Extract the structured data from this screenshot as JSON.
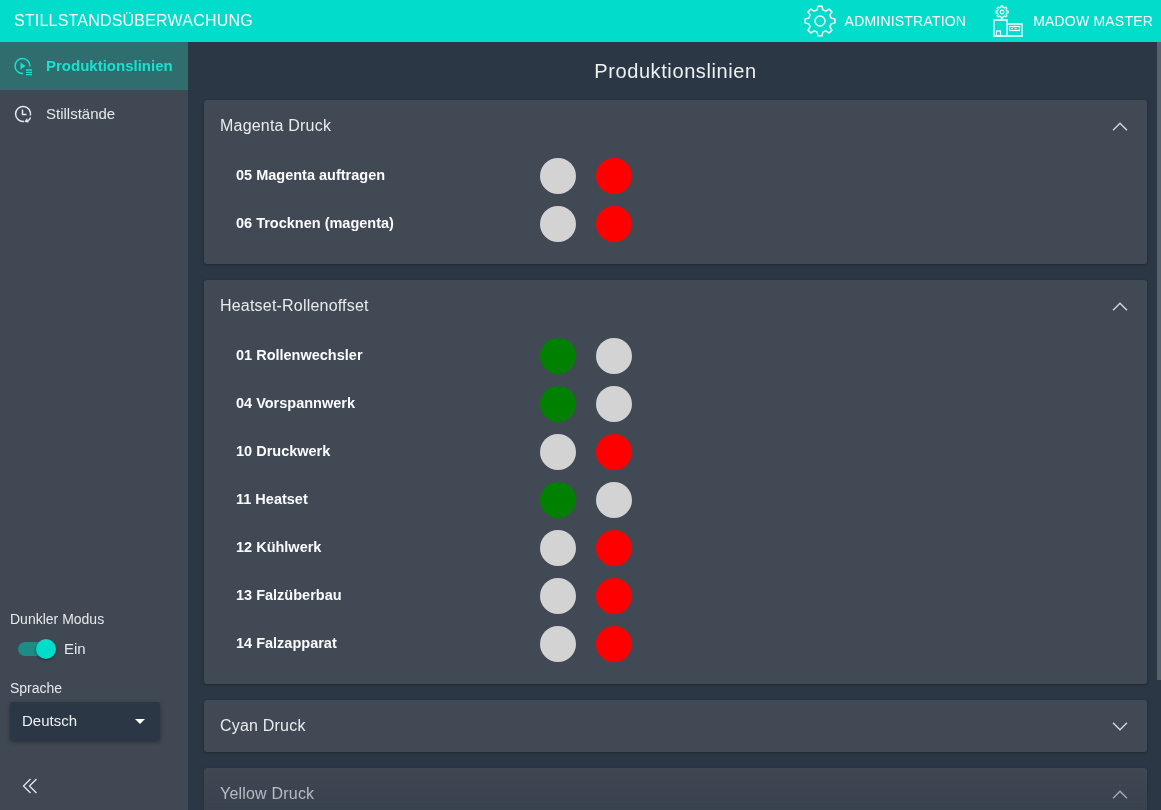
{
  "header": {
    "title": "STILLSTANDSÜBERWACHUNG",
    "links": [
      {
        "label": "ADMINISTRATION",
        "kind": "admin"
      },
      {
        "label": "MADOW MASTER",
        "kind": "master"
      }
    ]
  },
  "sidebar": {
    "items": [
      {
        "label": "Produktionslinien",
        "kind": "lines",
        "selected": true
      },
      {
        "label": "Stillstände",
        "kind": "downtimes",
        "selected": false
      }
    ],
    "dark_mode": {
      "label": "Dunkler Modus",
      "on": true,
      "state_label": "Ein"
    },
    "language": {
      "label": "Sprache",
      "value": "Deutsch"
    }
  },
  "page_title": "Produktionslinien",
  "lines": [
    {
      "name": "Magenta Druck",
      "expanded": true,
      "stations": [
        {
          "name": "05 Magenta auftragen",
          "lights": [
            {
              "color": "#d3d3d3"
            },
            {
              "color": "#ff0000"
            }
          ]
        },
        {
          "name": "06 Trocknen (magenta)",
          "lights": [
            {
              "color": "#d3d3d3"
            },
            {
              "color": "#ff0000"
            }
          ]
        }
      ]
    },
    {
      "name": "Heatset-Rollenoffset",
      "expanded": true,
      "stations": [
        {
          "name": "01 Rollenwechsler",
          "lights": [
            {
              "color": "#008000"
            },
            {
              "color": "#d3d3d3"
            }
          ]
        },
        {
          "name": "04 Vorspannwerk",
          "lights": [
            {
              "color": "#008000"
            },
            {
              "color": "#d3d3d3"
            }
          ]
        },
        {
          "name": "10 Druckwerk",
          "lights": [
            {
              "color": "#d3d3d3"
            },
            {
              "color": "#ff0000"
            }
          ]
        },
        {
          "name": "11 Heatset",
          "lights": [
            {
              "color": "#008000"
            },
            {
              "color": "#d3d3d3"
            }
          ]
        },
        {
          "name": "12 Kühlwerk",
          "lights": [
            {
              "color": "#d3d3d3"
            },
            {
              "color": "#ff0000"
            }
          ]
        },
        {
          "name": "13 Falzüberbau",
          "lights": [
            {
              "color": "#d3d3d3"
            },
            {
              "color": "#ff0000"
            }
          ]
        },
        {
          "name": "14 Falzapparat",
          "lights": [
            {
              "color": "#d3d3d3"
            },
            {
              "color": "#ff0000"
            }
          ]
        }
      ]
    },
    {
      "name": "Cyan Druck",
      "expanded": false
    },
    {
      "name": "Yellow Druck",
      "expanded": true
    }
  ]
}
